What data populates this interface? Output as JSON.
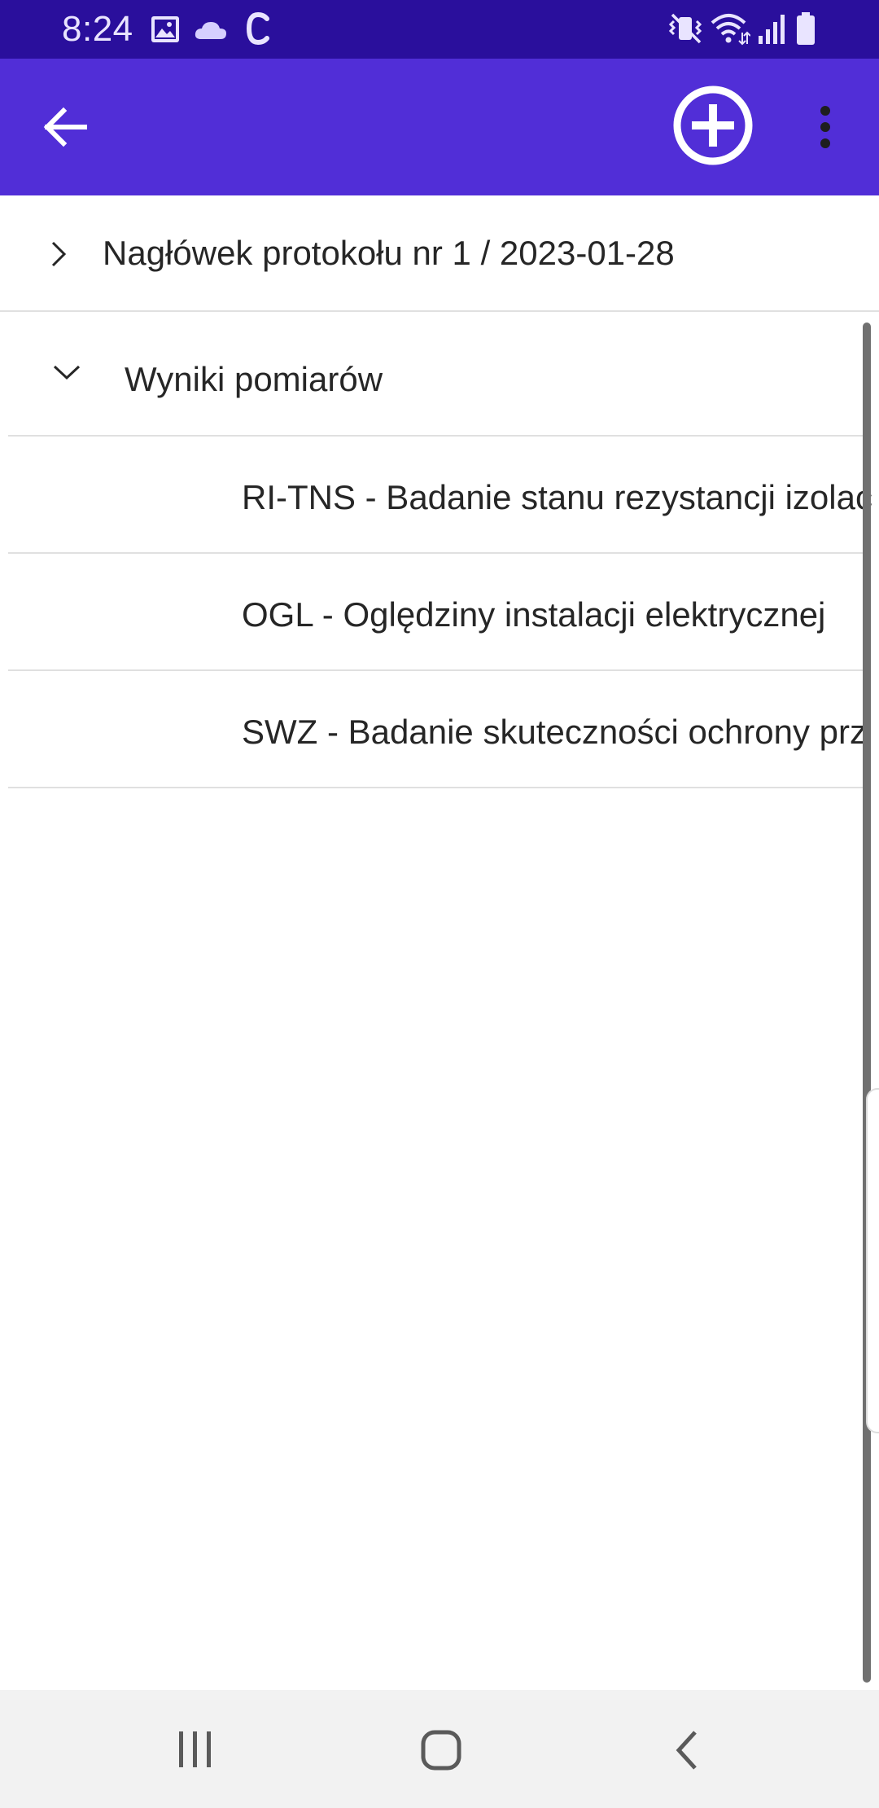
{
  "status_bar": {
    "time": "8:24",
    "left_icons": [
      "image-icon",
      "cloud-icon",
      "c-app-icon"
    ],
    "right_icons": [
      "vibrate-icon",
      "wifi-icon",
      "signal-icon",
      "battery-icon"
    ],
    "background": "#2a0f9c"
  },
  "app_bar": {
    "background": "#512ed7",
    "icons": [
      "back-arrow-icon",
      "add-circle-icon",
      "more-vert-icon"
    ]
  },
  "tree": {
    "header_item": {
      "label": "Nagłówek protokołu nr 1 / 2023-01-28",
      "expanded": false
    },
    "section": {
      "label": "Wyniki pomiarów",
      "expanded": true,
      "children": [
        {
          "label": "RI-TNS - Badanie stanu rezystancji izolac"
        },
        {
          "label": "OGL - Oględziny instalacji elektrycznej"
        },
        {
          "label": "SWZ - Badanie skuteczności ochrony prz"
        }
      ]
    }
  },
  "nav_bar": {
    "buttons": [
      "recent-apps-icon",
      "home-icon",
      "back-icon"
    ]
  }
}
